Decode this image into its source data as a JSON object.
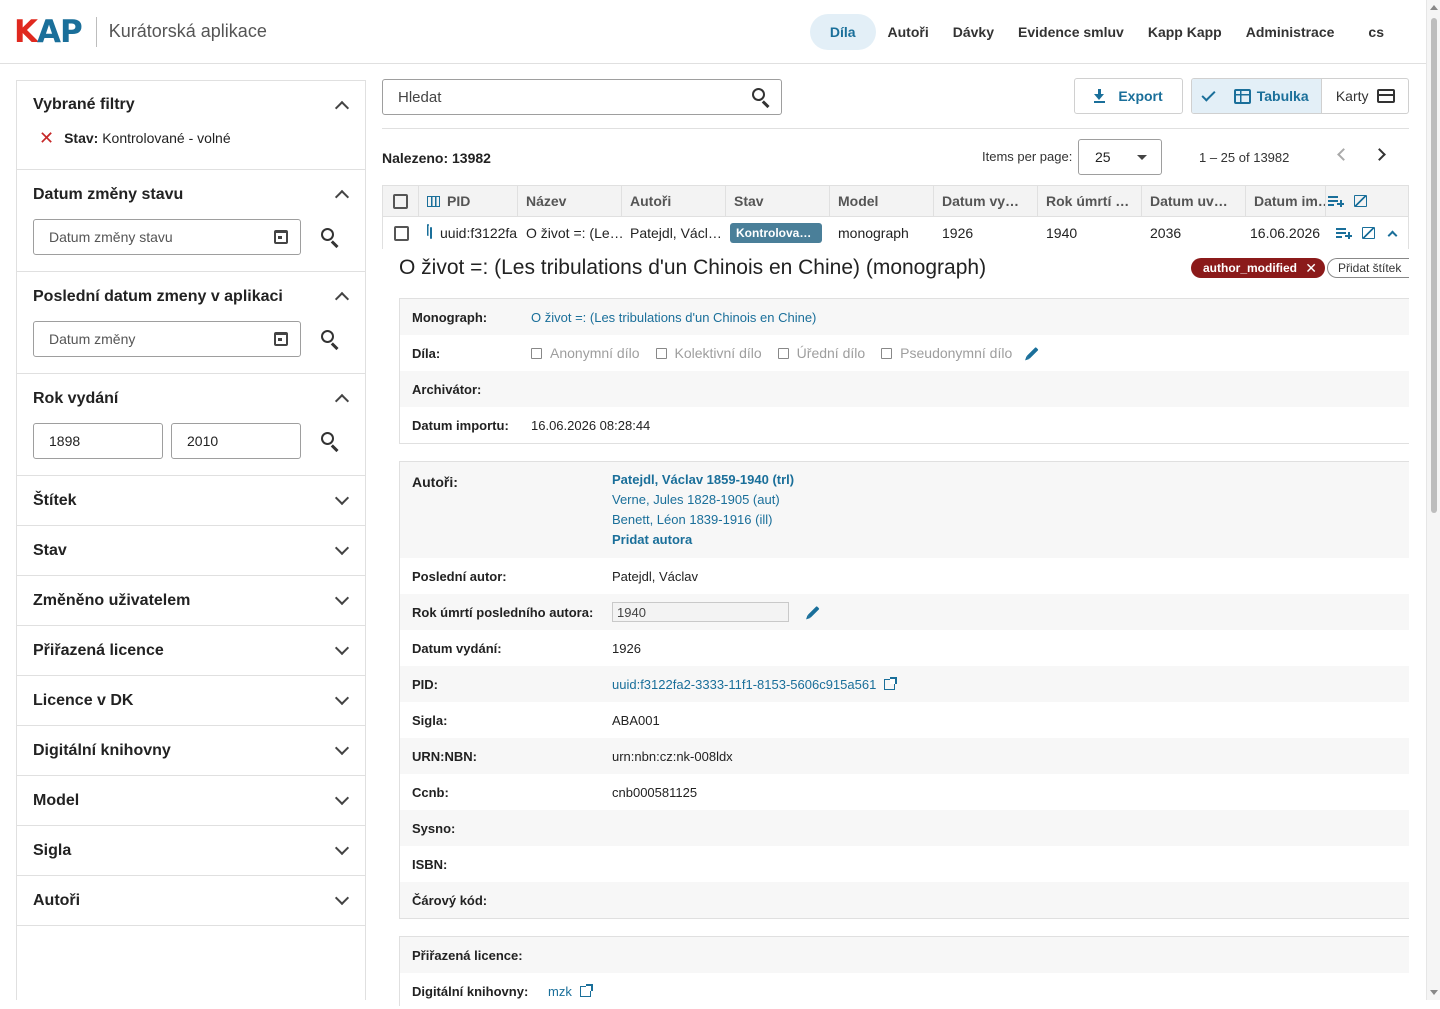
{
  "header": {
    "logo_k": "K",
    "logo_ap": "AP",
    "app_title": "Kurátorská aplikace",
    "nav": [
      "Díla",
      "Autoři",
      "Dávky",
      "Evidence smluv",
      "Kapp Kapp",
      "Administrace",
      "cs"
    ],
    "active_nav": "Díla"
  },
  "sidebar": {
    "selected_filters": {
      "title": "Vybrané filtry",
      "chip_key": "Stav:",
      "chip_value": "Kontrolované - volné"
    },
    "state_change_date": {
      "title": "Datum změny stavu",
      "placeholder": "Datum změny stavu"
    },
    "last_change_date": {
      "title": "Poslední datum zmeny v aplikaci",
      "placeholder": "Datum změny"
    },
    "publication_year": {
      "title": "Rok vydání",
      "from": "1898",
      "to": "2010"
    },
    "collapsed_panels": [
      "Štítek",
      "Stav",
      "Změněno uživatelem",
      "Přiřazená licence",
      "Licence v DK",
      "Digitální knihovny",
      "Model",
      "Sigla",
      "Autoři"
    ]
  },
  "toolbar": {
    "search_placeholder": "Hledat",
    "export_label": "Export",
    "view_table": "Tabulka",
    "view_cards": "Karty",
    "found_label": "Nalezeno: 13982",
    "items_per_page_label": "Items per page:",
    "items_per_page": "25",
    "range_label": "1 – 25 of 13982"
  },
  "table": {
    "columns": [
      "PID",
      "Název",
      "Autoři",
      "Stav",
      "Model",
      "Datum vy…",
      "Rok úmrtí …",
      "Datum uv…",
      "Datum im…"
    ],
    "row": {
      "pid": "uuid:f3122fa2",
      "title": "O život =: (Le…",
      "authors": "Patejdl, Václ…",
      "state": "Kontrolované…",
      "model": "monograph",
      "date_pub": "1926",
      "death_year": "1940",
      "date_free": "2036",
      "date_import": "16.06.2026"
    }
  },
  "detail": {
    "title": "O život =: (Les tribulations d'un Chinois en Chine) (monograph)",
    "tag": "author_modified",
    "add_tag": "Přidat štítek",
    "box1": {
      "monograph_label": "Monograph:",
      "monograph_value": "O život =: (Les tribulations d'un Chinois en Chine)",
      "works_label": "Díla:",
      "works_options": [
        "Anonymní dílo",
        "Kolektivní dílo",
        "Úřední dílo",
        "Pseudonymní dílo"
      ],
      "archivator_label": "Archivátor:",
      "import_label": "Datum importu:",
      "import_value": "16.06.2026 08:28:44"
    },
    "box2": {
      "authors_label": "Autoři:",
      "authors": [
        "Patejdl, Václav 1859-1940 (trl)",
        "Verne, Jules 1828-1905 (aut)",
        "Benett, Léon 1839-1916 (ill)"
      ],
      "add_author": "Pridat autora",
      "last_author_label": "Poslední autor:",
      "last_author_value": "Patejdl, Václav",
      "death_year_label": "Rok úmrtí posledního autora:",
      "death_year_value": "1940",
      "pub_date_label": "Datum vydání:",
      "pub_date_value": "1926",
      "pid_label": "PID:",
      "pid_value": "uuid:f3122fa2-3333-11f1-8153-5606c915a561",
      "sigla_label": "Sigla:",
      "sigla_value": "ABA001",
      "urn_label": "URN:NBN:",
      "urn_value": "urn:nbn:cz:nk-008ldx",
      "ccnb_label": "Ccnb:",
      "ccnb_value": "cnb000581125",
      "sysno_label": "Sysno:",
      "isbn_label": "ISBN:",
      "barcode_label": "Čárový kód:"
    },
    "box3": {
      "license_label": "Přiřazená licence:",
      "dl_label": "Digitální knihovny:",
      "dl_value": "mzk"
    }
  }
}
